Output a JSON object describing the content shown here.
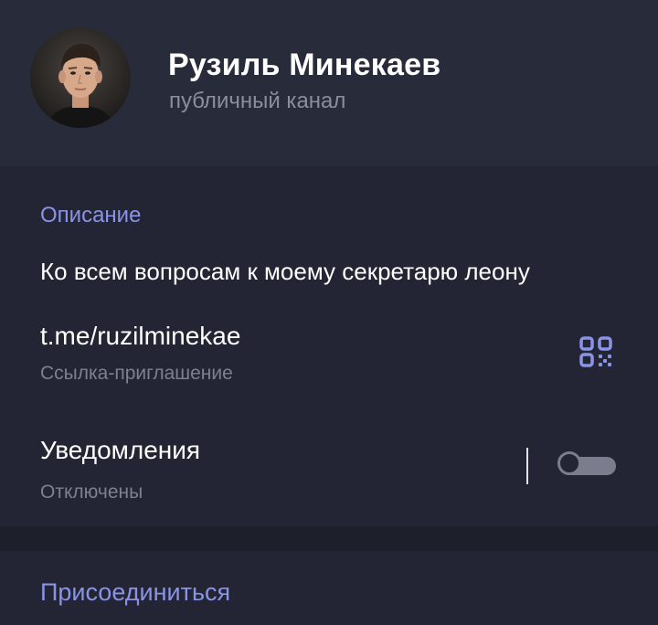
{
  "profile": {
    "name": "Рузиль Минекаев",
    "subtitle": "публичный канал"
  },
  "info": {
    "section_title": "Описание",
    "description": "Ко всем вопросам к моему секретарю леону",
    "link": "t.me/ruzilminekae",
    "link_caption": "Ссылка-приглашение",
    "qr_icon": "qr-code-icon",
    "notifications_title": "Уведомления",
    "notifications_status": "Отключены",
    "notifications_enabled": false
  },
  "actions": {
    "join_label": "Присоединиться"
  },
  "colors": {
    "accent": "#8a93e6",
    "header_bg": "#282b3a",
    "panel_bg": "#232534",
    "page_bg": "#1d1f2b",
    "muted_text": "#7d808d"
  }
}
